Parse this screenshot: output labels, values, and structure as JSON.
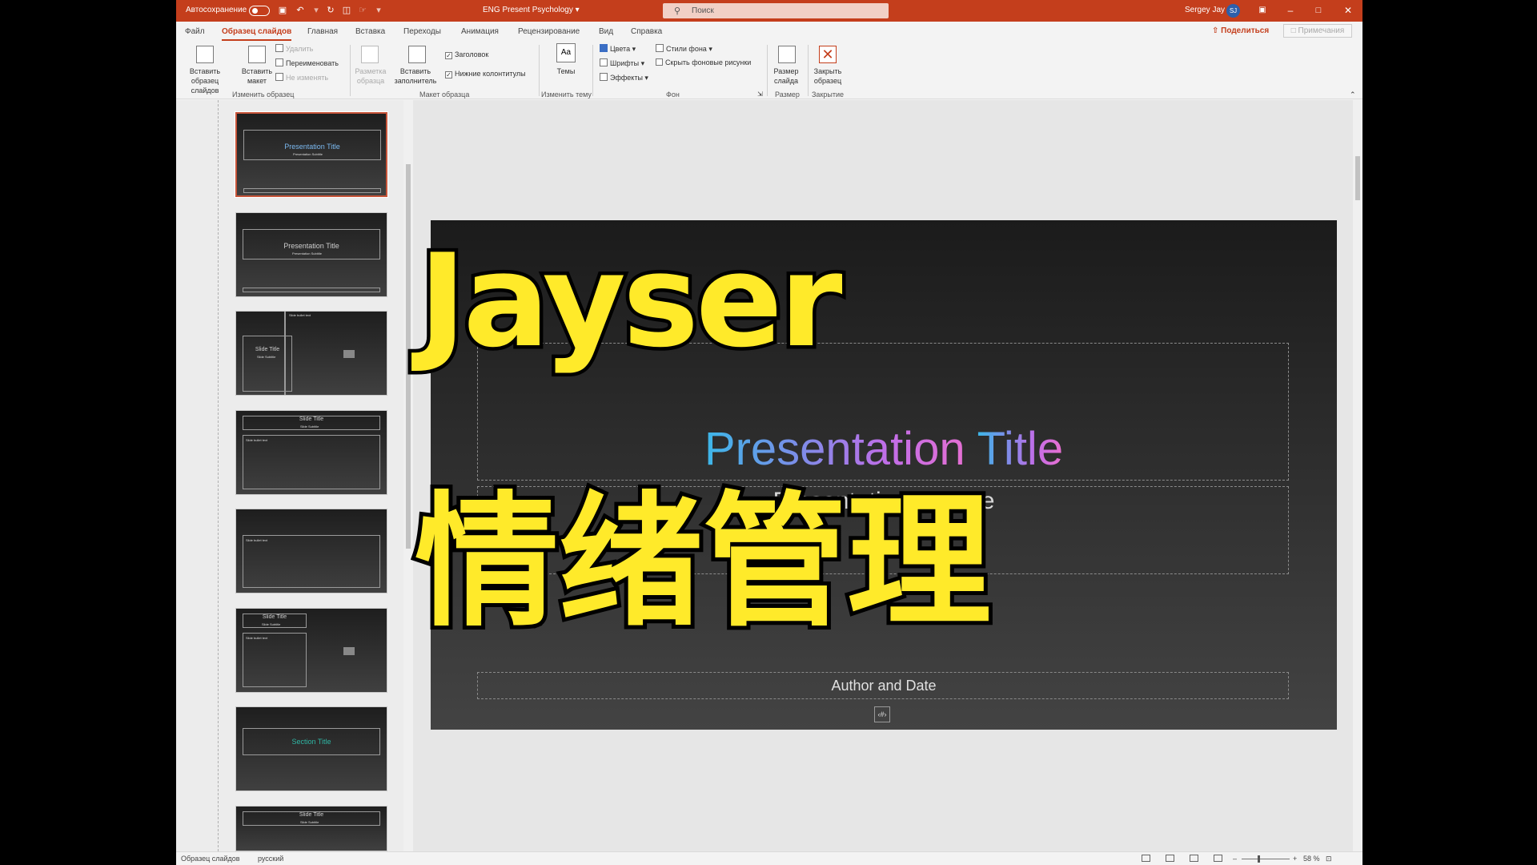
{
  "titlebar": {
    "autosave_label": "Автосохранение",
    "doc_title": "ENG Present Psychology",
    "search_placeholder": "Поиск",
    "user_name": "Sergey Jay",
    "user_initials": "SJ"
  },
  "menu": {
    "tabs": [
      "Файл",
      "Образец слайдов",
      "Главная",
      "Вставка",
      "Переходы",
      "Анимация",
      "Рецензирование",
      "Вид",
      "Справка"
    ],
    "share": "Поделиться",
    "comments": "Примечания"
  },
  "ribbon": {
    "edit_master": {
      "insert_master": "Вставить образец слайдов",
      "insert_layout": "Вставить макет",
      "delete": "Удалить",
      "rename": "Переименовать",
      "preserve": "Не изменять",
      "group_label": "Изменить образец"
    },
    "layout": {
      "master_layout": "Разметка образца",
      "insert_placeholder": "Вставить заполнитель",
      "title_check": "Заголовок",
      "footers_check": "Нижние колонтитулы",
      "group_label": "Макет образца"
    },
    "theme": {
      "themes": "Темы",
      "group_label": "Изменить тему"
    },
    "background": {
      "colors": "Цвета",
      "fonts": "Шрифты",
      "effects": "Эффекты",
      "bg_styles": "Стили фона",
      "hide_bg": "Скрыть фоновые рисунки",
      "group_label": "Фон"
    },
    "size": {
      "slide_size": "Размер слайда",
      "group_label": "Размер"
    },
    "close": {
      "close_master": "Закрыть образец",
      "group_label": "Закрытие"
    }
  },
  "thumbnails": [
    {
      "title": "Presentation Title",
      "subtitle": "Presentation Subtitle",
      "selected": true
    },
    {
      "title": "Presentation Title",
      "subtitle": "Presentation Subtitle"
    },
    {
      "title": "Slide Title",
      "subtitle": "Slide Subtitle",
      "bullet": "Slide bullet text"
    },
    {
      "title": "Slide Title",
      "subtitle": "Slide Subtitle",
      "bullet": "Slide bullet text"
    },
    {
      "bullet": "Slide bullet text"
    },
    {
      "title": "Slide Title",
      "subtitle": "Slide Subtitle",
      "bullet": "Slide bullet text"
    },
    {
      "title": "Section Title"
    },
    {
      "title": "Slide Title",
      "subtitle": "Slide Subtitle"
    }
  ],
  "slide": {
    "title_part1": "Presentation ",
    "title_part2": "Title",
    "subtitle": "Presentation Subtitle",
    "author": "Author and Date",
    "slide_number": "‹#›"
  },
  "overlay": {
    "line1": "Jayser",
    "line2": "情绪管理"
  },
  "statusbar": {
    "view": "Образец слайдов",
    "language": "русский",
    "zoom": "58 %"
  },
  "colors": {
    "accent": "#c43e1c",
    "overlay_yellow": "#ffea2a",
    "title_gradient_start": "#3cb7e8",
    "title_gradient_end": "#ea6fd0"
  }
}
